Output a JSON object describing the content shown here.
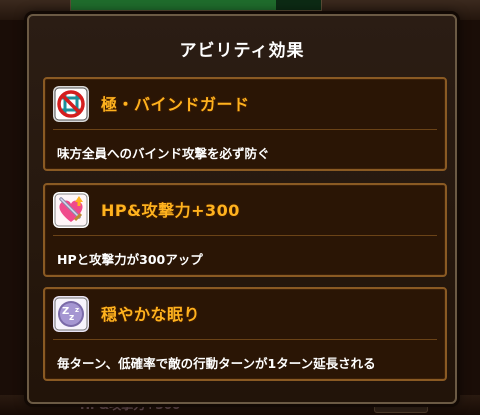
{
  "background": {
    "hp_label": "HP",
    "bottom_ability_text": "HP&攻撃力+300"
  },
  "dialog": {
    "title": "アビリティ効果",
    "abilities": [
      {
        "name": "極・バインドガード",
        "description": "味方全員へのバインド攻撃を必ず防ぐ",
        "icon": "bind-guard-icon",
        "color": "#ffb21e"
      },
      {
        "name": "HP&攻撃力+300",
        "description": "HPと攻撃力が300アップ",
        "icon": "heart-sword-icon",
        "color": "#ffb21e"
      },
      {
        "name": "穏やかな眠り",
        "description": "毎ターン、低確率で敵の行動ターンが1ターン延長される",
        "icon": "sleep-zzz-icon",
        "color": "#ffb21e"
      }
    ]
  }
}
